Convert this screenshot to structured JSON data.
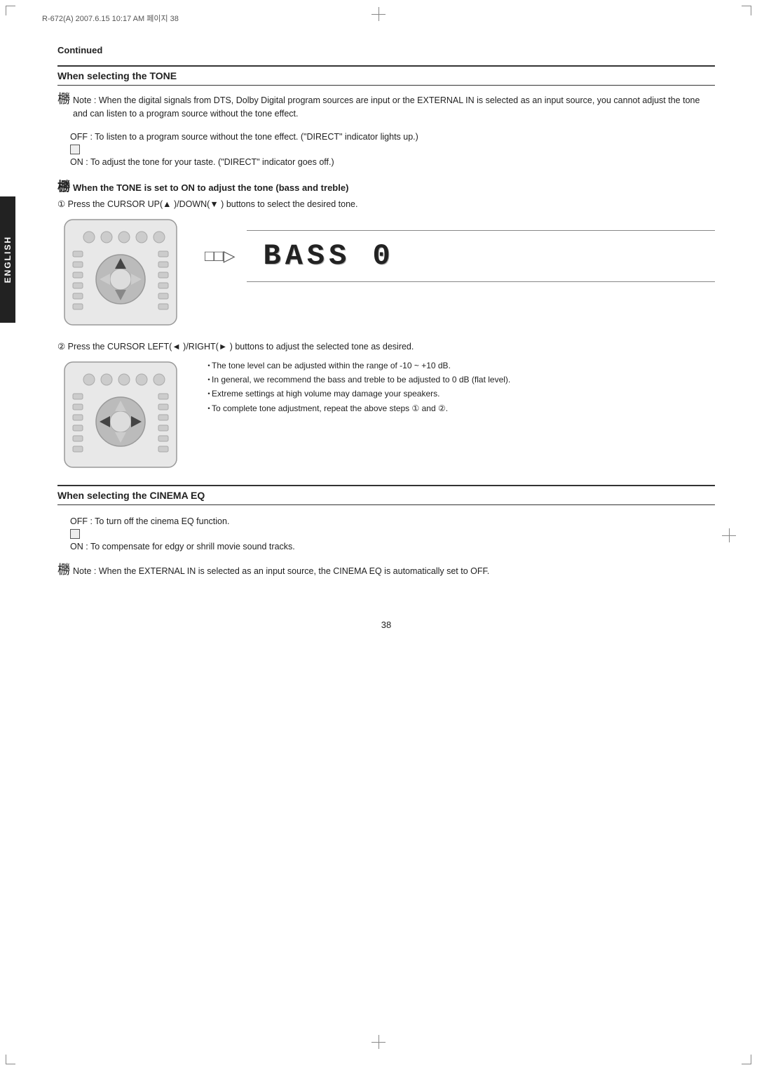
{
  "header": {
    "text": "R-672(A) 2007.6.15  10:17 AM  페이지 38"
  },
  "side_tab": {
    "label": "ENGLISH"
  },
  "continued": {
    "label": "Continued"
  },
  "tone_section": {
    "header": "When selecting the TONE",
    "note_icon": "橳",
    "note_text": "Note : When the digital signals from DTS, Dolby Digital program sources are input or the EXTERNAL IN is selected as an input source, you cannot adjust the tone and can listen to a program source without the tone effect.",
    "off_label": "OFF : To listen to a program source without the tone effect. (\"DIRECT\" indicator lights up.)",
    "checkbox_icon": "橳",
    "on_label": "ON : To adjust the tone for your taste. (\"DIRECT\" indicator goes off.)"
  },
  "tone_set_section": {
    "icon": "橳",
    "header": "When the TONE is set to ON to adjust the tone (bass and treble)",
    "step1_text": "① Press the CURSOR UP(▲ )/DOWN(▼ ) buttons to select the desired tone.",
    "arrow": "□□▷",
    "display_text": "BASS  0",
    "step2_text": "② Press the CURSOR LEFT(◄ )/RIGHT(► ) buttons to adjust the selected tone as desired.",
    "bullets": [
      "The tone level can be adjusted within the range of  -10 ~ +10 dB.",
      "In general, we recommend the bass and treble to be adjusted to 0 dB (flat level).",
      "Extreme settings at high volume may damage your speakers.",
      "To complete tone adjustment, repeat the above steps ① and ②."
    ]
  },
  "cinema_section": {
    "header": "When selecting the CINEMA EQ",
    "off_label": "OFF : To turn off the cinema EQ function.",
    "checkbox_icon": "橳",
    "on_label": "ON : To compensate for edgy or shrill movie sound tracks.",
    "note_icon": "橳",
    "note_text": "Note : When the EXTERNAL IN is selected as an input source, the CINEMA EQ is automatically set to OFF."
  },
  "page_number": "38"
}
